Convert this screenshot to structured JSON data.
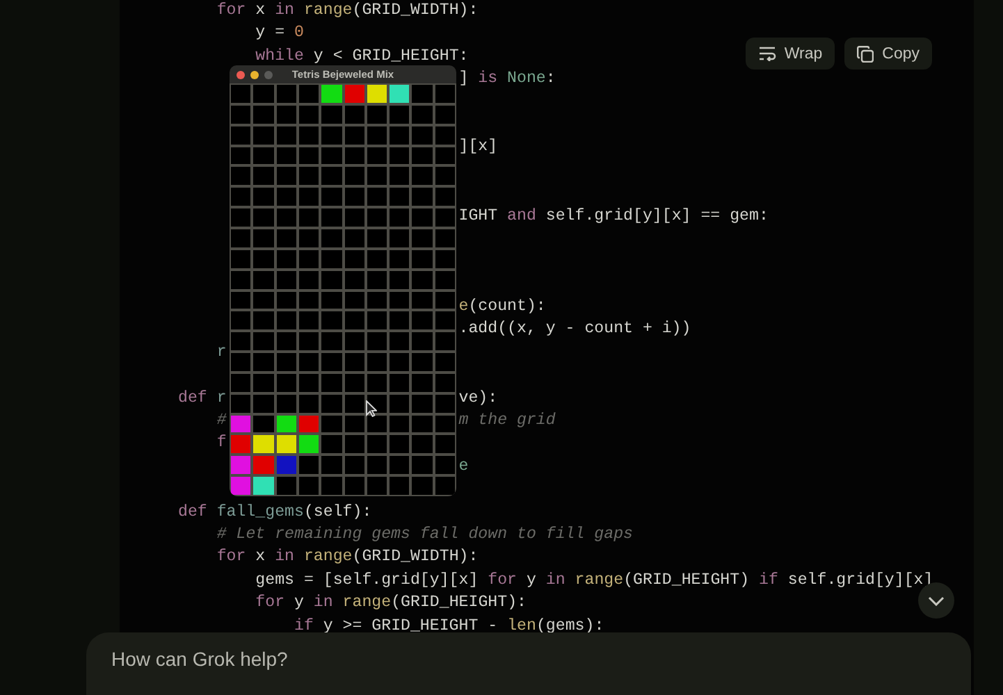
{
  "code_panel": {
    "buttons": [
      {
        "kind": "wrap",
        "label": "Wrap"
      },
      {
        "kind": "copy",
        "label": "Copy"
      }
    ],
    "lines": [
      {
        "kind": "full",
        "segments": [
          {
            "text": "    for",
            "kind": "kw"
          },
          {
            "text": " x",
            "kind": "plain"
          },
          {
            "text": " in",
            "kind": "kw"
          },
          {
            "text": " range",
            "kind": "fn"
          },
          {
            "text": "(GRID_WIDTH):",
            "kind": "plain"
          }
        ]
      },
      {
        "kind": "full",
        "segments": [
          {
            "text": "        y =",
            "kind": "plain"
          },
          {
            "text": " 0",
            "kind": "num"
          }
        ]
      },
      {
        "kind": "full",
        "segments": [
          {
            "text": "        while",
            "kind": "kw"
          },
          {
            "text": " y < GRID_HEIGHT:",
            "kind": "plain"
          }
        ]
      },
      {
        "kind": "split",
        "right": [
          {
            "text": "]",
            "kind": "plain"
          },
          {
            "text": " is",
            "kind": "kw"
          },
          {
            "text": " None",
            "kind": "const"
          },
          {
            "text": ":",
            "kind": "plain"
          }
        ]
      },
      {
        "kind": "blank"
      },
      {
        "kind": "blank"
      },
      {
        "kind": "split",
        "right": [
          {
            "text": "][x]",
            "kind": "plain"
          }
        ]
      },
      {
        "kind": "blank"
      },
      {
        "kind": "blank"
      },
      {
        "kind": "split",
        "right": [
          {
            "text": "IGHT",
            "kind": "plain"
          },
          {
            "text": " and",
            "kind": "kw"
          },
          {
            "text": " self.grid[y][x] == gem:",
            "kind": "plain"
          }
        ]
      },
      {
        "kind": "blank"
      },
      {
        "kind": "blank"
      },
      {
        "kind": "blank"
      },
      {
        "kind": "split",
        "right": [
          {
            "text": "e",
            "kind": "fn"
          },
          {
            "text": "(count):",
            "kind": "plain"
          }
        ]
      },
      {
        "kind": "split",
        "right": [
          {
            "text": ".add((x, y - count + i))",
            "kind": "plain"
          }
        ]
      },
      {
        "kind": "split",
        "left": [
          {
            "text": "    r",
            "kind": "name"
          }
        ]
      },
      {
        "kind": "blank"
      },
      {
        "kind": "split",
        "left": [
          {
            "text": "def",
            "kind": "kw"
          },
          {
            "text": " r",
            "kind": "name"
          }
        ],
        "right": [
          {
            "text": "ve):",
            "kind": "plain"
          }
        ]
      },
      {
        "kind": "split",
        "left": [
          {
            "text": "    #",
            "kind": "comment"
          }
        ],
        "right": [
          {
            "text": "m the grid",
            "kind": "comment"
          }
        ]
      },
      {
        "kind": "split",
        "left": [
          {
            "text": "    f",
            "kind": "kw"
          }
        ]
      },
      {
        "kind": "split",
        "right": [
          {
            "text": "e",
            "kind": "const"
          }
        ]
      },
      {
        "kind": "blank"
      },
      {
        "kind": "full",
        "segments": [
          {
            "text": "def",
            "kind": "kw"
          },
          {
            "text": " fall_gems",
            "kind": "name"
          },
          {
            "text": "(self):",
            "kind": "plain"
          }
        ]
      },
      {
        "kind": "full",
        "segments": [
          {
            "text": "    # Let remaining gems fall down to fill gaps",
            "kind": "comment"
          }
        ]
      },
      {
        "kind": "full",
        "segments": [
          {
            "text": "    for",
            "kind": "kw"
          },
          {
            "text": " x",
            "kind": "plain"
          },
          {
            "text": " in",
            "kind": "kw"
          },
          {
            "text": " range",
            "kind": "fn"
          },
          {
            "text": "(GRID_WIDTH):",
            "kind": "plain"
          }
        ]
      },
      {
        "kind": "full",
        "segments": [
          {
            "text": "        gems = [self.grid[y][x]",
            "kind": "plain"
          },
          {
            "text": " for",
            "kind": "kw"
          },
          {
            "text": " y",
            "kind": "plain"
          },
          {
            "text": " in",
            "kind": "kw"
          },
          {
            "text": " range",
            "kind": "fn"
          },
          {
            "text": "(GRID_HEIGHT)",
            "kind": "plain"
          },
          {
            "text": " if",
            "kind": "kw"
          },
          {
            "text": " self.grid[y][x]",
            "kind": "plain"
          }
        ]
      },
      {
        "kind": "full",
        "segments": [
          {
            "text": "        for",
            "kind": "kw"
          },
          {
            "text": " y",
            "kind": "plain"
          },
          {
            "text": " in",
            "kind": "kw"
          },
          {
            "text": " range",
            "kind": "fn"
          },
          {
            "text": "(GRID_HEIGHT):",
            "kind": "plain"
          }
        ]
      },
      {
        "kind": "full",
        "segments": [
          {
            "text": "            if",
            "kind": "kw"
          },
          {
            "text": " y >= GRID_HEIGHT -",
            "kind": "plain"
          },
          {
            "text": " len",
            "kind": "fn"
          },
          {
            "text": "(gems):",
            "kind": "plain"
          }
        ]
      }
    ]
  },
  "game_window": {
    "title": "Tetris Bejeweled Mix",
    "rows": [
      [
        {
          "kind": "empty"
        },
        {
          "kind": "empty"
        },
        {
          "kind": "empty"
        },
        {
          "kind": "empty"
        },
        {
          "kind": "gem",
          "color": "#12dc12"
        },
        {
          "kind": "gem",
          "color": "#e00000"
        },
        {
          "kind": "gem",
          "color": "#dede00"
        },
        {
          "kind": "gem",
          "color": "#30e0b4"
        },
        {
          "kind": "empty"
        },
        {
          "kind": "empty"
        }
      ],
      [
        {
          "kind": "empty"
        },
        {
          "kind": "empty"
        },
        {
          "kind": "empty"
        },
        {
          "kind": "empty"
        },
        {
          "kind": "empty"
        },
        {
          "kind": "empty"
        },
        {
          "kind": "empty"
        },
        {
          "kind": "empty"
        },
        {
          "kind": "empty"
        },
        {
          "kind": "empty"
        }
      ],
      [
        {
          "kind": "empty"
        },
        {
          "kind": "empty"
        },
        {
          "kind": "empty"
        },
        {
          "kind": "empty"
        },
        {
          "kind": "empty"
        },
        {
          "kind": "empty"
        },
        {
          "kind": "empty"
        },
        {
          "kind": "empty"
        },
        {
          "kind": "empty"
        },
        {
          "kind": "empty"
        }
      ],
      [
        {
          "kind": "empty"
        },
        {
          "kind": "empty"
        },
        {
          "kind": "empty"
        },
        {
          "kind": "empty"
        },
        {
          "kind": "empty"
        },
        {
          "kind": "empty"
        },
        {
          "kind": "empty"
        },
        {
          "kind": "empty"
        },
        {
          "kind": "empty"
        },
        {
          "kind": "empty"
        }
      ],
      [
        {
          "kind": "empty"
        },
        {
          "kind": "empty"
        },
        {
          "kind": "empty"
        },
        {
          "kind": "empty"
        },
        {
          "kind": "empty"
        },
        {
          "kind": "empty"
        },
        {
          "kind": "empty"
        },
        {
          "kind": "empty"
        },
        {
          "kind": "empty"
        },
        {
          "kind": "empty"
        }
      ],
      [
        {
          "kind": "empty"
        },
        {
          "kind": "empty"
        },
        {
          "kind": "empty"
        },
        {
          "kind": "empty"
        },
        {
          "kind": "empty"
        },
        {
          "kind": "empty"
        },
        {
          "kind": "empty"
        },
        {
          "kind": "empty"
        },
        {
          "kind": "empty"
        },
        {
          "kind": "empty"
        }
      ],
      [
        {
          "kind": "empty"
        },
        {
          "kind": "empty"
        },
        {
          "kind": "empty"
        },
        {
          "kind": "empty"
        },
        {
          "kind": "empty"
        },
        {
          "kind": "empty"
        },
        {
          "kind": "empty"
        },
        {
          "kind": "empty"
        },
        {
          "kind": "empty"
        },
        {
          "kind": "empty"
        }
      ],
      [
        {
          "kind": "empty"
        },
        {
          "kind": "empty"
        },
        {
          "kind": "empty"
        },
        {
          "kind": "empty"
        },
        {
          "kind": "empty"
        },
        {
          "kind": "empty"
        },
        {
          "kind": "empty"
        },
        {
          "kind": "empty"
        },
        {
          "kind": "empty"
        },
        {
          "kind": "empty"
        }
      ],
      [
        {
          "kind": "empty"
        },
        {
          "kind": "empty"
        },
        {
          "kind": "empty"
        },
        {
          "kind": "empty"
        },
        {
          "kind": "empty"
        },
        {
          "kind": "empty"
        },
        {
          "kind": "empty"
        },
        {
          "kind": "empty"
        },
        {
          "kind": "empty"
        },
        {
          "kind": "empty"
        }
      ],
      [
        {
          "kind": "empty"
        },
        {
          "kind": "empty"
        },
        {
          "kind": "empty"
        },
        {
          "kind": "empty"
        },
        {
          "kind": "empty"
        },
        {
          "kind": "empty"
        },
        {
          "kind": "empty"
        },
        {
          "kind": "empty"
        },
        {
          "kind": "empty"
        },
        {
          "kind": "empty"
        }
      ],
      [
        {
          "kind": "empty"
        },
        {
          "kind": "empty"
        },
        {
          "kind": "empty"
        },
        {
          "kind": "empty"
        },
        {
          "kind": "empty"
        },
        {
          "kind": "empty"
        },
        {
          "kind": "empty"
        },
        {
          "kind": "empty"
        },
        {
          "kind": "empty"
        },
        {
          "kind": "empty"
        }
      ],
      [
        {
          "kind": "empty"
        },
        {
          "kind": "empty"
        },
        {
          "kind": "empty"
        },
        {
          "kind": "empty"
        },
        {
          "kind": "empty"
        },
        {
          "kind": "empty"
        },
        {
          "kind": "empty"
        },
        {
          "kind": "empty"
        },
        {
          "kind": "empty"
        },
        {
          "kind": "empty"
        }
      ],
      [
        {
          "kind": "empty"
        },
        {
          "kind": "empty"
        },
        {
          "kind": "empty"
        },
        {
          "kind": "empty"
        },
        {
          "kind": "empty"
        },
        {
          "kind": "empty"
        },
        {
          "kind": "empty"
        },
        {
          "kind": "empty"
        },
        {
          "kind": "empty"
        },
        {
          "kind": "empty"
        }
      ],
      [
        {
          "kind": "empty"
        },
        {
          "kind": "empty"
        },
        {
          "kind": "empty"
        },
        {
          "kind": "empty"
        },
        {
          "kind": "empty"
        },
        {
          "kind": "empty"
        },
        {
          "kind": "empty"
        },
        {
          "kind": "empty"
        },
        {
          "kind": "empty"
        },
        {
          "kind": "empty"
        }
      ],
      [
        {
          "kind": "empty"
        },
        {
          "kind": "empty"
        },
        {
          "kind": "empty"
        },
        {
          "kind": "empty"
        },
        {
          "kind": "empty"
        },
        {
          "kind": "empty"
        },
        {
          "kind": "empty"
        },
        {
          "kind": "empty"
        },
        {
          "kind": "empty"
        },
        {
          "kind": "empty"
        }
      ],
      [
        {
          "kind": "empty"
        },
        {
          "kind": "empty"
        },
        {
          "kind": "empty"
        },
        {
          "kind": "empty"
        },
        {
          "kind": "empty"
        },
        {
          "kind": "empty"
        },
        {
          "kind": "empty"
        },
        {
          "kind": "empty"
        },
        {
          "kind": "empty"
        },
        {
          "kind": "empty"
        }
      ],
      [
        {
          "kind": "gem",
          "color": "#e010e0"
        },
        {
          "kind": "empty"
        },
        {
          "kind": "gem",
          "color": "#12dc12"
        },
        {
          "kind": "gem",
          "color": "#e00000"
        },
        {
          "kind": "empty"
        },
        {
          "kind": "empty"
        },
        {
          "kind": "empty"
        },
        {
          "kind": "empty"
        },
        {
          "kind": "empty"
        },
        {
          "kind": "empty"
        }
      ],
      [
        {
          "kind": "gem",
          "color": "#e00000"
        },
        {
          "kind": "gem",
          "color": "#dede00"
        },
        {
          "kind": "gem",
          "color": "#dede00"
        },
        {
          "kind": "gem",
          "color": "#12dc12"
        },
        {
          "kind": "empty"
        },
        {
          "kind": "empty"
        },
        {
          "kind": "empty"
        },
        {
          "kind": "empty"
        },
        {
          "kind": "empty"
        },
        {
          "kind": "empty"
        }
      ],
      [
        {
          "kind": "gem",
          "color": "#e010e0"
        },
        {
          "kind": "gem",
          "color": "#e00000"
        },
        {
          "kind": "gem",
          "color": "#1212c0"
        },
        {
          "kind": "empty"
        },
        {
          "kind": "empty"
        },
        {
          "kind": "empty"
        },
        {
          "kind": "empty"
        },
        {
          "kind": "empty"
        },
        {
          "kind": "empty"
        },
        {
          "kind": "empty"
        }
      ],
      [
        {
          "kind": "gem",
          "color": "#e010e0"
        },
        {
          "kind": "gem",
          "color": "#30e0b4"
        },
        {
          "kind": "empty"
        },
        {
          "kind": "empty"
        },
        {
          "kind": "empty"
        },
        {
          "kind": "empty"
        },
        {
          "kind": "empty"
        },
        {
          "kind": "empty"
        },
        {
          "kind": "empty"
        },
        {
          "kind": "empty"
        }
      ]
    ]
  },
  "prompt": {
    "placeholder": "How can Grok help?"
  }
}
